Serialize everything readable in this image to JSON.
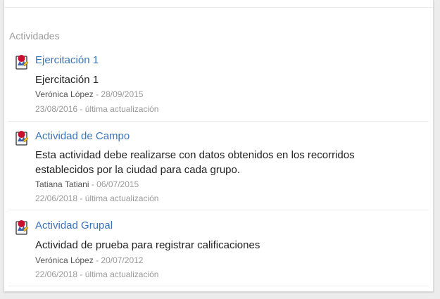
{
  "section": {
    "title": "Actividades"
  },
  "activities": [
    {
      "title": "Ejercitación 1",
      "description": "Ejercitación 1",
      "author": "Verónica López",
      "date": "28/09/2015",
      "updated_date": "23/08/2016",
      "updated_label": "última actualización",
      "icon": "assignment-icon"
    },
    {
      "title": "Actividad de Campo",
      "description": "Esta actividad debe realizarse con datos obtenidos en los recorridos establecidos por la ciudad para cada grupo.",
      "author": "Tatiana Tatiani",
      "date": "06/07/2015",
      "updated_date": "22/06/2018",
      "updated_label": "última actualización",
      "icon": "assignment-icon"
    },
    {
      "title": "Actividad Grupal",
      "description": "Actividad de prueba para registrar calificaciones",
      "author": "Verónica López",
      "date": "20/07/2012",
      "updated_date": "22/06/2018",
      "updated_label": "última actualización",
      "icon": "assignment-icon"
    }
  ],
  "colors": {
    "link": "#3b73b9",
    "muted": "#999999",
    "icon_red": "#c8102e"
  }
}
